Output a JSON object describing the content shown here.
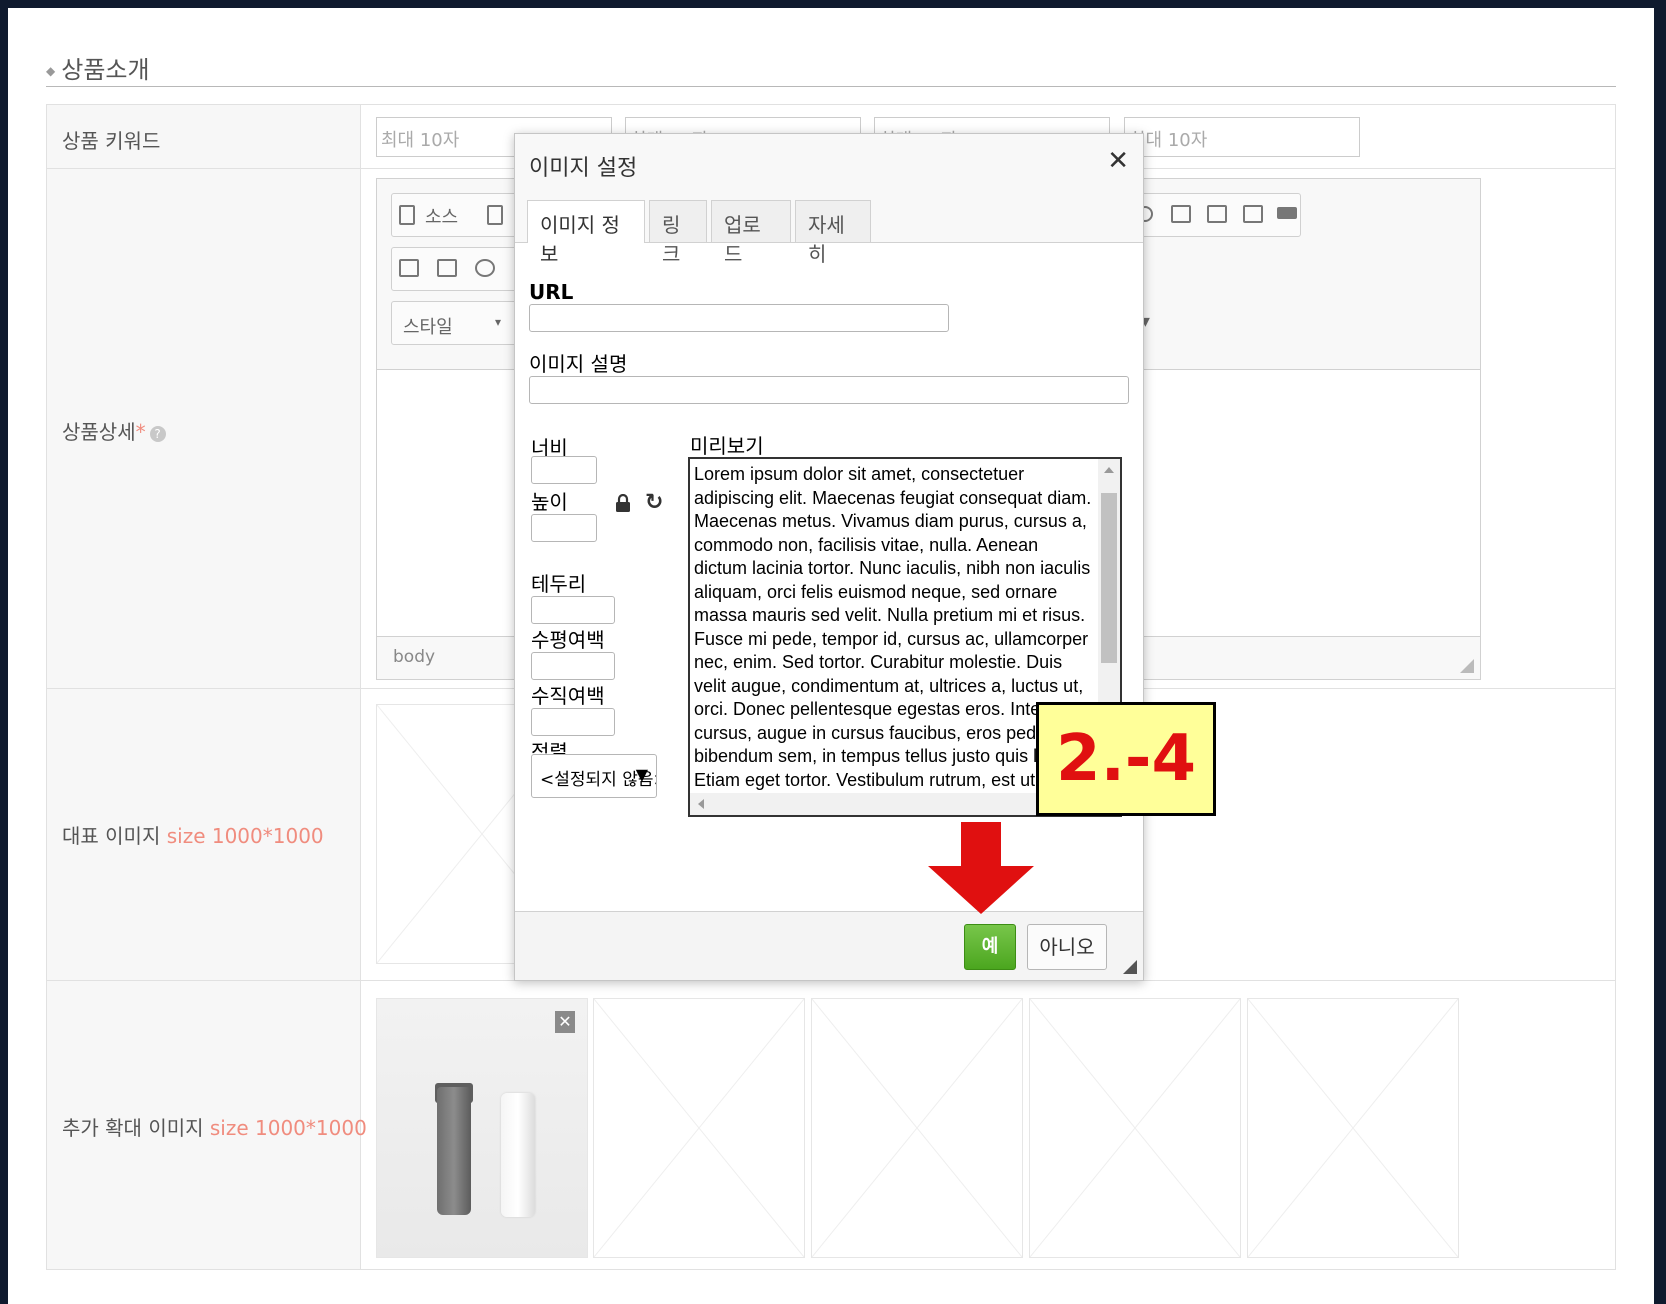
{
  "section": {
    "title": "상품소개"
  },
  "rows": {
    "keyword": {
      "label": "상품 키워드",
      "placeholders": [
        "최대 10자",
        "최대 10자",
        "최대 10자",
        "최대 10자"
      ]
    },
    "detail": {
      "label": "상품상세",
      "required_mark": "*",
      "help": "?"
    },
    "main_image": {
      "label": "대표 이미지",
      "size_note": "size 1000*1000"
    },
    "extra_images": {
      "label": "추가 확대 이미지",
      "size_note": "size 1000*1000",
      "remove_label": "✕"
    }
  },
  "editor": {
    "source_label": "소스",
    "style_label": "스타일",
    "path_label": "body"
  },
  "dialog": {
    "title": "이미지 설정",
    "close": "✕",
    "tabs": [
      "이미지 정보",
      "링크",
      "업로드",
      "자세히"
    ],
    "url_label": "URL",
    "alt_label": "이미지 설명",
    "width_label": "너비",
    "height_label": "높이",
    "border_label": "테두리",
    "hspace_label": "수평여백",
    "vspace_label": "수직여백",
    "align_label": "정렬",
    "align_value": "<설정되지 않음>",
    "preview_label": "미리보기",
    "preview_text": "Lorem ipsum dolor sit amet, consectetuer adipiscing elit. Maecenas feugiat consequat diam. Maecenas metus. Vivamus diam purus, cursus a, commodo non, facilisis vitae, nulla. Aenean dictum lacinia tortor. Nunc iaculis, nibh non iaculis aliquam, orci felis euismod neque, sed ornare massa mauris sed velit. Nulla pretium mi et risus. Fusce mi pede, tempor id, cursus ac, ullamcorper nec, enim. Sed tortor. Curabitur molestie. Duis velit augue, condimentum at, ultrices a, luctus ut, orci. Donec pellentesque egestas eros. Integer cursus, augue in cursus faucibus, eros pede bibendum sem, in tempus tellus justo quis ligula. Etiam eget tortor. Vestibulum rutrum, est ut placerat elementum",
    "ok_label": "예",
    "cancel_label": "아니오"
  },
  "annotation": {
    "step": "2.-4"
  },
  "colors": {
    "accent_red": "#e01010",
    "ok_green": "#4ba61f",
    "badge_bg": "#ffff99"
  }
}
